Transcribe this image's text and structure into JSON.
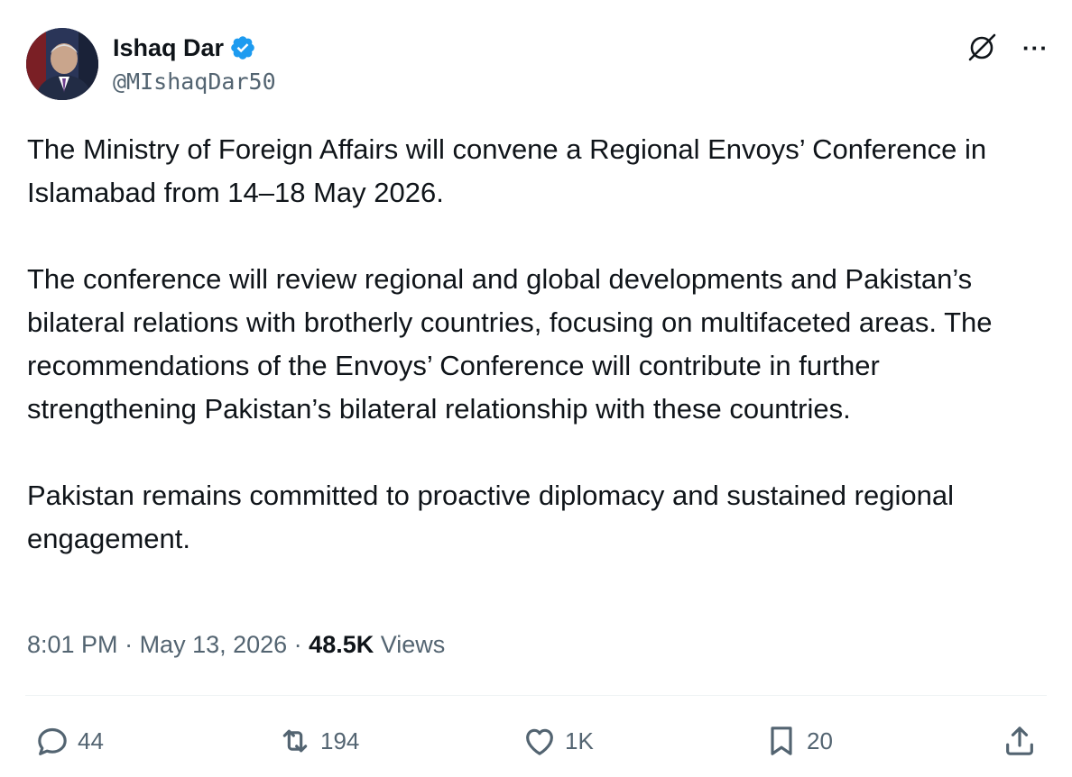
{
  "author": {
    "name": "Ishaq Dar",
    "handle": "@MIshaqDar50",
    "verified": true,
    "verified_color": "#1d9bf0"
  },
  "top_actions": {
    "grok_icon": "grok-slash-icon",
    "more_icon": "more-horizontal-icon",
    "more_label": "···"
  },
  "tweet": {
    "paragraphs": [
      "The Ministry of Foreign Affairs will convene a Regional Envoys’ Conference in Islamabad from 14–18 May 2026.",
      "The conference will review regional and global developments and Pakistan’s bilateral relations with brotherly countries, focusing on multifaceted areas. The recommendations of the Envoys’ Conference will contribute in further strengthening Pakistan’s bilateral relationship with these countries.",
      "Pakistan remains committed to proactive diplomacy and sustained regional engagement."
    ]
  },
  "meta": {
    "time": "8:01 PM",
    "separator": " · ",
    "date": "May 13, 2026",
    "views_count": "48.5K",
    "views_label": "Views"
  },
  "actions": {
    "reply": {
      "icon": "reply-icon",
      "count": "44"
    },
    "retweet": {
      "icon": "retweet-icon",
      "count": "194"
    },
    "like": {
      "icon": "heart-icon",
      "count": "1K"
    },
    "bookmark": {
      "icon": "bookmark-icon",
      "count": "20"
    },
    "share": {
      "icon": "share-icon"
    }
  },
  "colors": {
    "text_primary": "#0f1419",
    "text_secondary": "#536471",
    "divider": "#eff3f4",
    "accent": "#1d9bf0"
  }
}
